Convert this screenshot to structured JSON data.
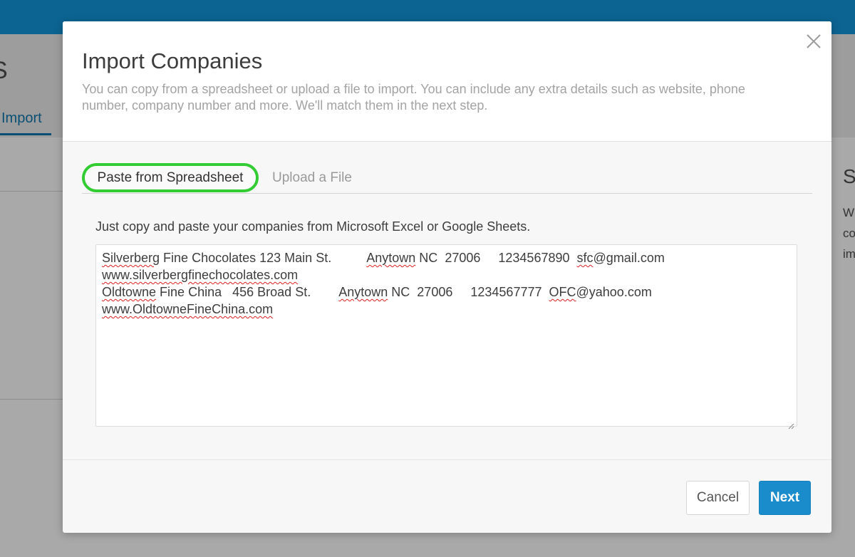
{
  "background": {
    "page_title_fragment": "S",
    "active_tab_label": "Import",
    "right_panel_title_fragment": "S",
    "right_panel_text_lines": [
      "W",
      "co",
      "im"
    ]
  },
  "modal": {
    "title": "Import Companies",
    "subtitle": "You can copy from a spreadsheet or upload a file to import. You can include any extra details such as website, phone number, company number and more. We'll match them in the next step.",
    "close_icon": "close-icon",
    "tabs": [
      {
        "label": "Paste from Spreadsheet",
        "active": true
      },
      {
        "label": "Upload a File",
        "active": false
      }
    ],
    "instructions": "Just copy and paste your companies from Microsoft Excel or Google Sheets.",
    "pasted_rows": [
      {
        "name_word": "Silverberg",
        "name_rest": " Fine Chocolates",
        "address": "123 Main St.",
        "city": "Anytown",
        "state": "NC",
        "zip": "27006",
        "phone": "1234567890",
        "email_user": "sfc",
        "email_domain": "@gmail.com",
        "website": "www.silverbergfinechocolates.com"
      },
      {
        "name_word": "Oldtowne",
        "name_rest": " Fine China",
        "address": "456 Broad St.",
        "city": "Anytown",
        "state": "NC",
        "zip": "27006",
        "phone": "1234567777",
        "email_user": "OFC",
        "email_domain": "@yahoo.com",
        "website": "www.OldtowneFineChina.com"
      }
    ],
    "buttons": {
      "cancel_label": "Cancel",
      "next_label": "Next"
    }
  },
  "colors": {
    "topbar": "#0c6492",
    "primary_button": "#1a8ccc",
    "tab_highlight": "#33cc33",
    "spellcheck": "#e02020"
  }
}
